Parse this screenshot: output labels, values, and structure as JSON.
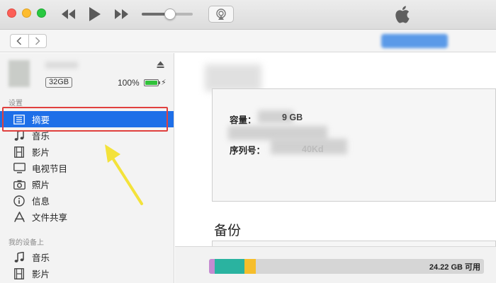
{
  "player": {
    "controls": [
      "rewind",
      "play",
      "fast-forward"
    ],
    "volume_level": 0.55
  },
  "sidebar": {
    "device": {
      "capacity": "32GB",
      "battery_pct": "100%",
      "battery_level": 1.0,
      "charging": true
    },
    "settings_header": "设置",
    "settings_items": [
      {
        "label": "摘要",
        "icon": "summary-icon",
        "selected": true
      },
      {
        "label": "音乐",
        "icon": "music-note-icon"
      },
      {
        "label": "影片",
        "icon": "film-icon"
      },
      {
        "label": "电视节目",
        "icon": "tv-icon"
      },
      {
        "label": "照片",
        "icon": "camera-icon"
      },
      {
        "label": "信息",
        "icon": "info-icon"
      },
      {
        "label": "文件共享",
        "icon": "app-store-icon"
      }
    ],
    "on_device_header": "我的设备上",
    "on_device_items": [
      {
        "label": "音乐",
        "icon": "music-note-icon"
      },
      {
        "label": "影片",
        "icon": "film-icon"
      }
    ]
  },
  "main": {
    "capacity_label": "容量：",
    "capacity_value": "9 GB",
    "serial_label": "序列号：",
    "serial_value": "40Kd",
    "backup_title": "备份"
  },
  "storage": {
    "free_label": "24.22 GB 可用",
    "segments": [
      {
        "name": "other",
        "fraction": 0.02,
        "color": "#c58bd1"
      },
      {
        "name": "apps",
        "fraction": 0.11,
        "color": "#2ab3a0"
      },
      {
        "name": "documents",
        "fraction": 0.04,
        "color": "#f6be2c"
      }
    ]
  },
  "colors": {
    "selection": "#1e6fe8",
    "highlight_box": "#e0403e",
    "arrow": "#f3e23a"
  }
}
